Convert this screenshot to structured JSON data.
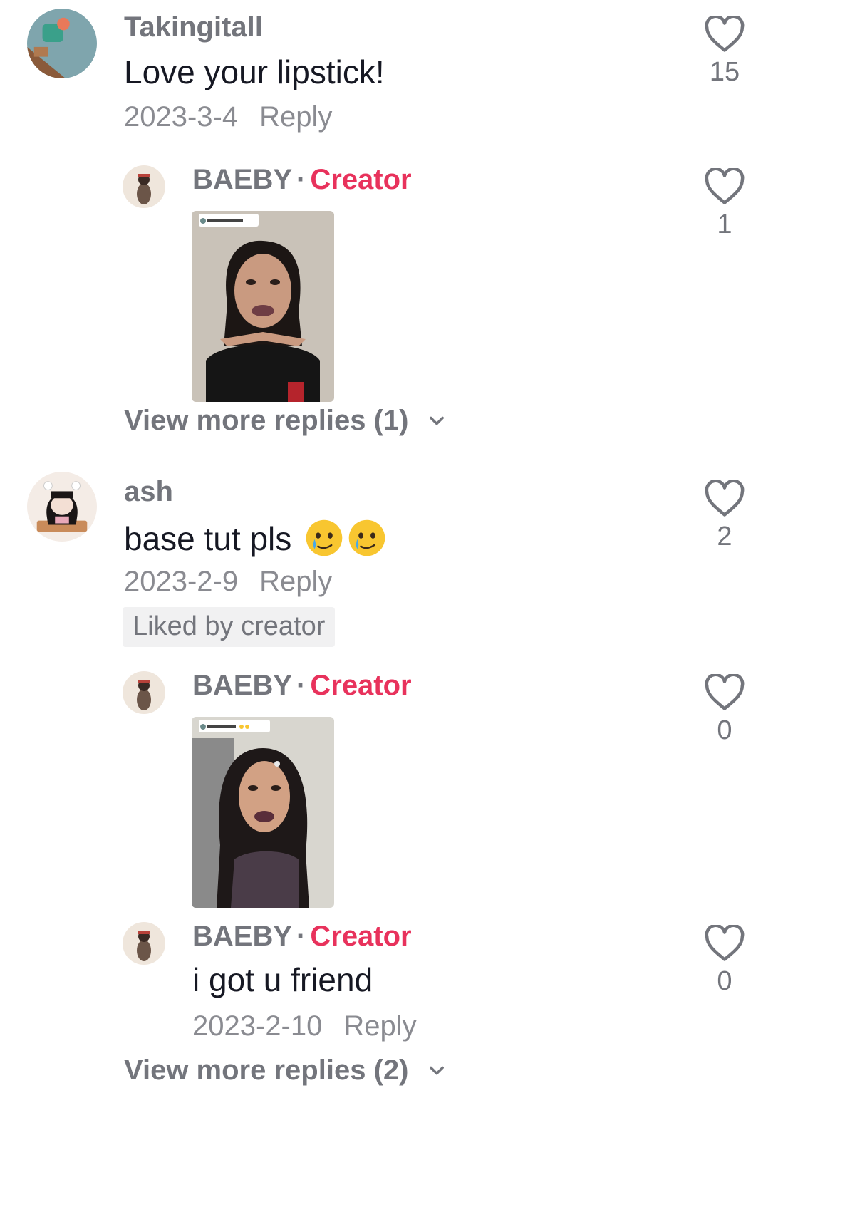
{
  "comments": [
    {
      "username": "Takingitall",
      "text": "Love your lipstick!",
      "date": "2023-3-4",
      "reply_label": "Reply",
      "likes": "15",
      "icon": "heart-outline-icon"
    },
    {
      "username": "ash",
      "text": "base tut pls",
      "emoji": [
        "face-holding-back-tears-emoji",
        "face-holding-back-tears-emoji"
      ],
      "date": "2023-2-9",
      "reply_label": "Reply",
      "likes": "2",
      "liked_badge": "Liked by creator",
      "icon": "heart-outline-icon"
    }
  ],
  "replies": [
    {
      "username": "BAEBY",
      "separator": "·",
      "role": "Creator",
      "type": "video-reply",
      "likes": "1"
    },
    {
      "username": "BAEBY",
      "separator": "·",
      "role": "Creator",
      "type": "video-reply",
      "likes": "0"
    },
    {
      "username": "BAEBY",
      "separator": "·",
      "role": "Creator",
      "text": "i got u friend",
      "date": "2023-2-10",
      "reply_label": "Reply",
      "likes": "0"
    }
  ],
  "view_more": [
    {
      "label": "View more replies (1)"
    },
    {
      "label": "View more replies (2)"
    }
  ],
  "colors": {
    "creator_accent": "#e8325c",
    "secondary_text": "#73757c",
    "meta_text": "#8a8b91",
    "badge_bg": "#f1f1f2"
  }
}
